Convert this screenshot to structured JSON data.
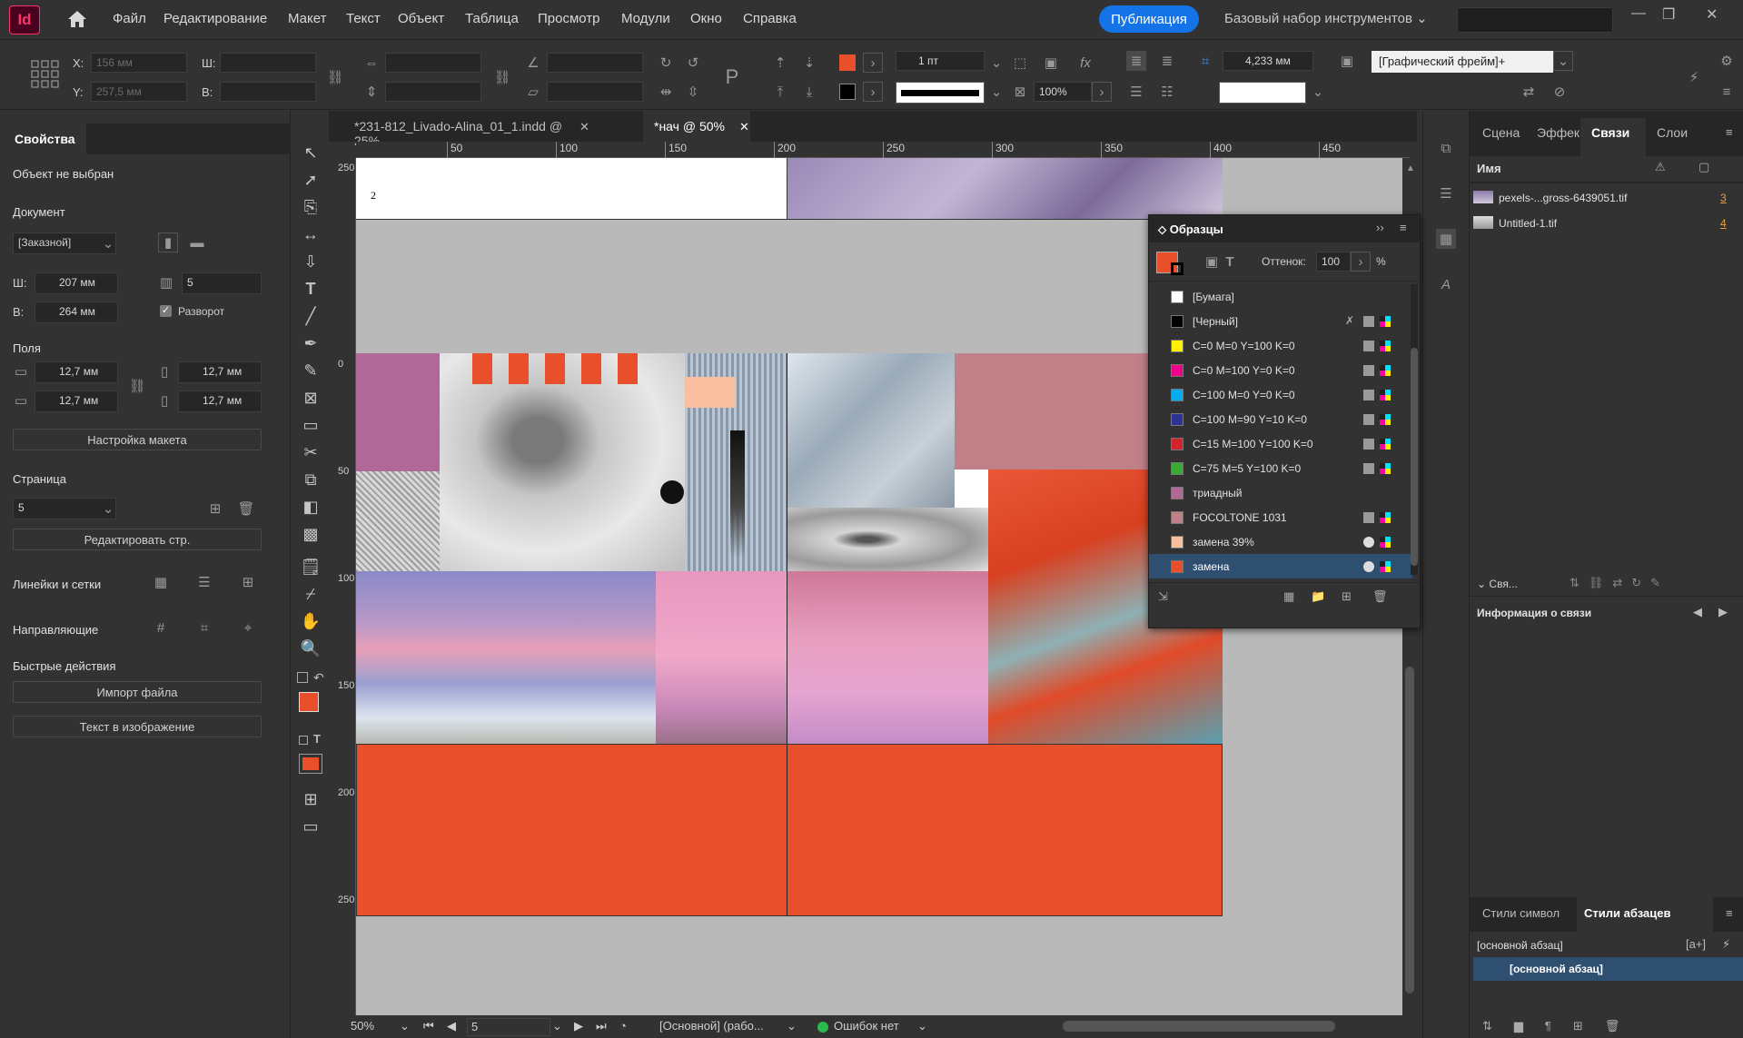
{
  "app": {
    "logo": "Id"
  },
  "menu": [
    "Файл",
    "Редактирование",
    "Макет",
    "Текст",
    "Объект",
    "Таблица",
    "Просмотр",
    "Модули",
    "Окно",
    "Справка"
  ],
  "publish_label": "Публикация",
  "workspace": "Базовый набор инструментов",
  "control": {
    "x_label": "X:",
    "y_label": "Y:",
    "w_label": "Ш:",
    "h_label": "В:",
    "x_value": "156 мм",
    "y_value": "257,5 мм",
    "stroke_weight": "1 пт",
    "opacity": "100%",
    "spacing": "4,233 мм",
    "frame_style": "[Графический фрейм]+"
  },
  "properties": {
    "tab": "Свойства",
    "no_selection": "Объект не выбран",
    "document_title": "Документ",
    "preset": "[Заказной]",
    "width_label": "Ш:",
    "width": "207 мм",
    "height_label": "В:",
    "height": "264 мм",
    "pages": "5",
    "spread_label": "Разворот",
    "margins_title": "Поля",
    "margin_top": "12,7 мм",
    "margin_bottom": "12,7 мм",
    "margin_left": "12,7 мм",
    "margin_right": "12,7 мм",
    "layout_button": "Настройка макета",
    "page_title": "Страница",
    "page_value": "5",
    "edit_page_button": "Редактировать стр.",
    "rulers_title": "Линейки и сетки",
    "guides_title": "Направляющие",
    "quick_title": "Быстрые действия",
    "import_button": "Импорт файла",
    "text_image_button": "Текст в изображение"
  },
  "doc_tabs": [
    {
      "label": "*231-812_Livado-Alina_01_1.indd @ 25%",
      "active": false
    },
    {
      "label": "*нач @ 50%",
      "active": true
    }
  ],
  "ruler_h": [
    "50",
    "100",
    "150",
    "200",
    "250",
    "300",
    "350",
    "400",
    "450"
  ],
  "ruler_v": [
    {
      "text": "250"
    },
    {
      "text": "0"
    },
    {
      "text": "50"
    },
    {
      "text": "100"
    },
    {
      "text": "150"
    },
    {
      "text": "200"
    },
    {
      "text": "250"
    }
  ],
  "page_number_text": "2",
  "colors": {
    "accent": "#e8502b",
    "pink": "#b06898",
    "rose": "#c08088",
    "peach": "#f8c0a0"
  },
  "swatches": {
    "title": "Образцы",
    "tint_label": "Оттенок:",
    "tint_value": "100",
    "tint_unit": "%",
    "items": [
      {
        "name": "[Бумага]",
        "color": "#ffffff"
      },
      {
        "name": "[Черный]",
        "color": "#000000"
      },
      {
        "name": "C=0 M=0 Y=100 K=0",
        "color": "#fff200"
      },
      {
        "name": "C=0 M=100 Y=0 K=0",
        "color": "#ec008c"
      },
      {
        "name": "C=100 M=0 Y=0 K=0",
        "color": "#00aeef"
      },
      {
        "name": "C=100 M=90 Y=10 K=0",
        "color": "#2e3192"
      },
      {
        "name": "C=15 M=100 Y=100 K=0",
        "color": "#d2232a"
      },
      {
        "name": "C=75 M=5 Y=100 K=0",
        "color": "#3aaa35"
      },
      {
        "name": "триадный",
        "color": "#b06898"
      },
      {
        "name": "FOCOLTONE 1031",
        "color": "#c08088"
      },
      {
        "name": "замена  39%",
        "color": "#f8c0a0"
      },
      {
        "name": "замена",
        "color": "#e8502b"
      }
    ]
  },
  "links": {
    "tabs": [
      "Сцена",
      "Эффек",
      "Связи",
      "Слои"
    ],
    "name_header": "Имя",
    "items": [
      {
        "name": "pexels-...gross-6439051.tif",
        "page": "3"
      },
      {
        "name": "Untitled-1.tif",
        "page": "4"
      }
    ],
    "section": "Свя...",
    "info_title": "Информация о связи"
  },
  "styles": {
    "tabs": [
      "Стили символ",
      "Стили абзацев"
    ],
    "current": "[основной абзац]",
    "selected": "[основной абзац]"
  },
  "status": {
    "zoom": "50%",
    "page": "5",
    "profile": "[Основной] (рабо...",
    "errors": "Ошибок нет"
  }
}
